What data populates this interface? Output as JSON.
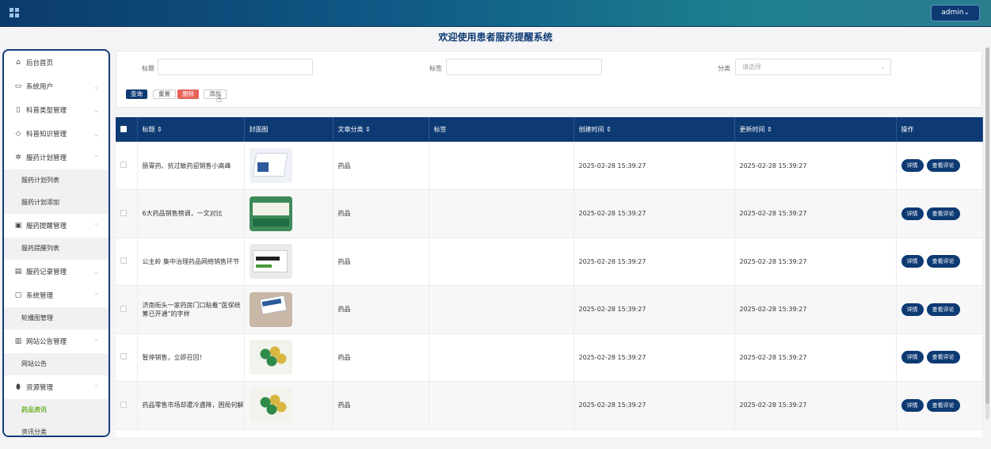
{
  "header": {
    "admin_label": "admin⌄"
  },
  "page_title": "欢迎使用患者服药提醒系统",
  "sidebar": {
    "home": "后台首页",
    "items": [
      {
        "label": "系统用户",
        "icon": "monitor-icon",
        "chev": "⌄"
      },
      {
        "label": "科普类型管理",
        "icon": "bookmark-icon",
        "chev": "⌄"
      },
      {
        "label": "科普知识管理",
        "icon": "tag-icon",
        "chev": "⌄"
      },
      {
        "label": "服药计划管理",
        "icon": "gear-icon",
        "chev": "⌃",
        "subs": [
          "服药计划列表",
          "服药计划添加"
        ]
      },
      {
        "label": "服药提醒管理",
        "icon": "calendar-icon",
        "chev": "⌃",
        "subs": [
          "服药提醒列表"
        ]
      },
      {
        "label": "服药记录管理",
        "icon": "clipboard-icon",
        "chev": "⌄"
      },
      {
        "label": "系统管理",
        "icon": "message-icon",
        "chev": "⌃",
        "subs": [
          "轮播图管理"
        ]
      },
      {
        "label": "网站公告管理",
        "icon": "archive-icon",
        "chev": "⌃",
        "subs": [
          "网站公告"
        ]
      },
      {
        "label": "资源管理",
        "icon": "pill-icon",
        "chev": "⌃",
        "subs": [
          "药品资讯",
          "资讯分类"
        ]
      }
    ]
  },
  "search": {
    "title_label": "标题",
    "tag_label": "标签",
    "category_label": "分类",
    "category_placeholder": "请选择",
    "query": "查询",
    "reset": "重置",
    "delete": "删除",
    "add": "添加"
  },
  "table": {
    "headers": {
      "title": "标题 ⇕",
      "cover": "封面图",
      "category": "文章分类 ⇕",
      "tag": "标签",
      "created": "创建时间 ⇕",
      "updated": "更新时间 ⇕",
      "ops": "操作"
    },
    "detail_label": "详情",
    "comment_label": "查看评论",
    "rows": [
      {
        "title": "肠胃药、抗过敏药迎销售小高峰",
        "category": "药品",
        "tag": "",
        "created": "2025-02-28 15:39:27",
        "updated": "2025-02-28 15:39:27"
      },
      {
        "title": "6大药品销售榜调，一文对比",
        "category": "药品",
        "tag": "",
        "created": "2025-02-28 15:39:27",
        "updated": "2025-02-28 15:39:27"
      },
      {
        "title": "公主岭 集中治理药品网络销售环节",
        "category": "药品",
        "tag": "",
        "created": "2025-02-28 15:39:27",
        "updated": "2025-02-28 15:39:27"
      },
      {
        "title": "济南街头一家药房门口贴着“医保统筹已开通”的字样",
        "category": "药品",
        "tag": "",
        "created": "2025-02-28 15:39:27",
        "updated": "2025-02-28 15:39:27"
      },
      {
        "title": "暂停销售，立即召回！",
        "category": "药品",
        "tag": "",
        "created": "2025-02-28 15:39:27",
        "updated": "2025-02-28 15:39:27"
      },
      {
        "title": "药品零售市场却遭冷遇降，困局何解",
        "category": "药品",
        "tag": "",
        "created": "2025-02-28 15:39:27",
        "updated": "2025-02-28 15:39:27"
      }
    ]
  },
  "colors": {
    "primary": "#0d3a73",
    "active": "#6bb32f",
    "danger": "#e8635a"
  }
}
